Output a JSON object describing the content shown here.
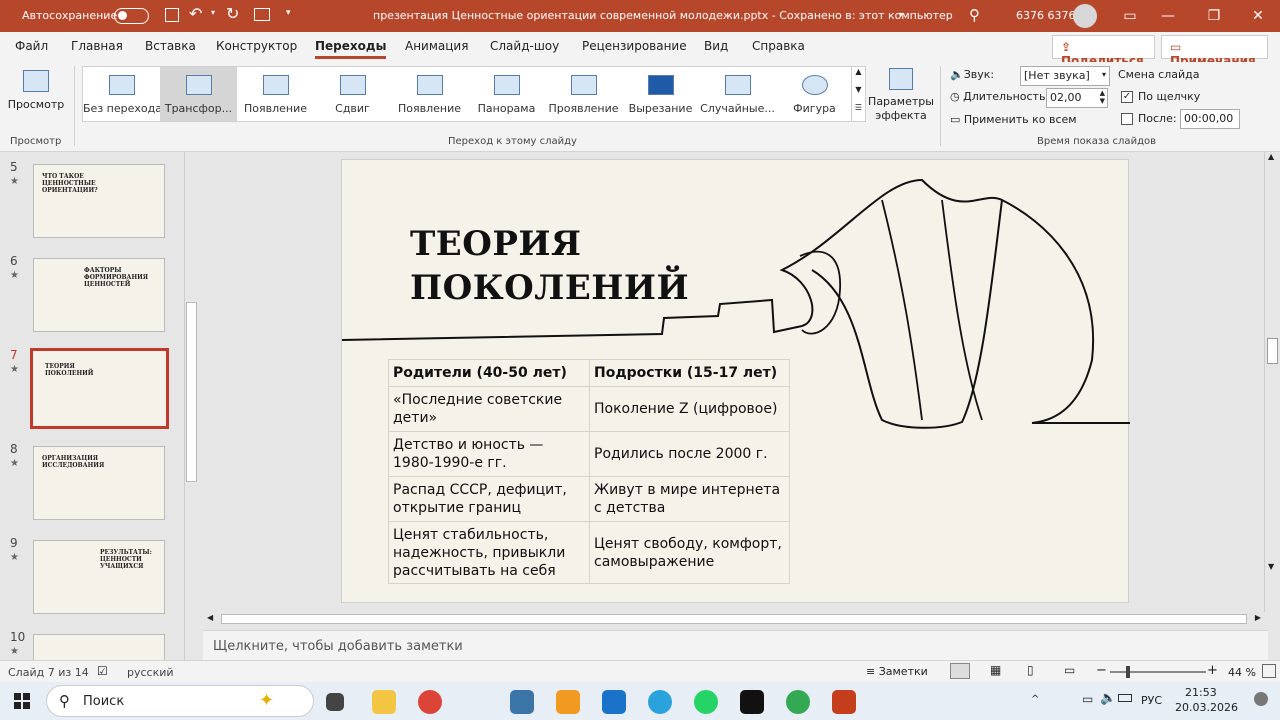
{
  "app": {
    "autosave_label": "Автосохранение",
    "doc_title": "презентация Ценностные ориентации современной молодежи.pptx  -  Сохранено в: этот компьютер",
    "user": "6376 6376"
  },
  "menu": {
    "tabs": [
      "Файл",
      "Главная",
      "Вставка",
      "Конструктор",
      "Переходы",
      "Анимация",
      "Слайд-шоу",
      "Рецензирование",
      "Вид",
      "Справка"
    ],
    "share": "Поделиться",
    "comments": "Примечания"
  },
  "ribbon": {
    "preview_label": "Просмотр",
    "preview_group": "Просмотр",
    "transitions": [
      "Без перехода",
      "Трансфор...",
      "Появление",
      "Сдвиг",
      "Появление",
      "Панорама",
      "Проявление",
      "Вырезание",
      "Случайные...",
      "Фигура"
    ],
    "params_label": "Параметры эффекта",
    "group_transition": "Переход к этому слайду",
    "sound_label": "Звук:",
    "sound_value": "[Нет звука]",
    "duration_label": "Длительность:",
    "duration_value": "02,00",
    "apply_all": "Применить ко всем",
    "advance_label": "Смена слайда",
    "on_click": "По щелчку",
    "after_label": "После:",
    "after_value": "00:00,00",
    "group_timing": "Время показа слайдов"
  },
  "thumbs": [
    {
      "num": "5",
      "title": "ЧТО ТАКОЕ ЦЕННОСТНЫЕ ОРИЕНТАЦИИ?"
    },
    {
      "num": "6",
      "title": "ФАКТОРЫ ФОРМИРОВАНИЯ ЦЕННОСТЕЙ"
    },
    {
      "num": "7",
      "title": "ТЕОРИЯ ПОКОЛЕНИЙ"
    },
    {
      "num": "8",
      "title": "ОРГАНИЗАЦИЯ ИССЛЕДОВАНИЯ"
    },
    {
      "num": "9",
      "title": "РЕЗУЛЬТАТЫ: ЦЕННОСТИ УЧАЩИХСЯ"
    },
    {
      "num": "10",
      "title": ""
    }
  ],
  "thumb_star": "★",
  "slide": {
    "title_line1": "ТЕОРИЯ",
    "title_line2": "ПОКОЛЕНИЙ",
    "table": {
      "headers": [
        "Родители (40-50 лет)",
        "Подростки (15-17 лет)"
      ],
      "rows": [
        [
          "«Последние советские дети»",
          "Поколение Z (цифровое)"
        ],
        [
          "Детство и юность — 1980-1990-е гг.",
          "Родились после 2000 г."
        ],
        [
          "Распад СССР, дефицит, открытие границ",
          "Живут в мире интернета с детства"
        ],
        [
          "Ценят стабильность, надежность, привыкли рассчитывать на себя",
          "Ценят свободу, комфорт, самовыражение"
        ]
      ]
    }
  },
  "notes_placeholder": "Щелкните, чтобы добавить заметки",
  "status": {
    "slide_count": "Слайд 7 из 14",
    "language": "русский",
    "notes_btn": "Заметки",
    "zoom": "44 %"
  },
  "taskbar": {
    "search": "Поиск",
    "lang": "РУС",
    "time": "21:53",
    "date": "20.03.2026"
  },
  "colors": {
    "accent": "#b7472a",
    "slide_bg": "#f5f2ea",
    "selected_border": "#c0392b"
  }
}
